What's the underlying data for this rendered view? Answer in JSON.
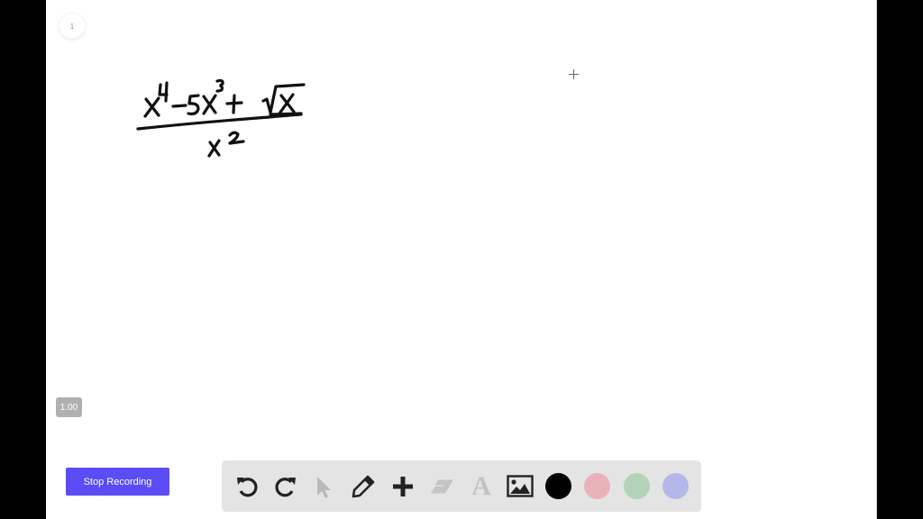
{
  "page": {
    "number": "1"
  },
  "whiteboard": {
    "handwritten_expression": "(x^4 - 5x^3 + √x) / x^2",
    "numerator": "x⁴ − 5x³ + √x",
    "denominator": "x²"
  },
  "zoom_level": "1.00",
  "recording": {
    "stop_label": "Stop Recording"
  },
  "toolbar": {
    "tools": [
      {
        "name": "undo",
        "icon": "undo-icon"
      },
      {
        "name": "redo",
        "icon": "redo-icon"
      },
      {
        "name": "select",
        "icon": "cursor-arrow-icon",
        "state": "disabled"
      },
      {
        "name": "pen",
        "icon": "pencil-icon"
      },
      {
        "name": "add",
        "icon": "plus-icon"
      },
      {
        "name": "eraser",
        "icon": "eraser-icon",
        "state": "disabled"
      },
      {
        "name": "text",
        "icon": "text-icon",
        "label": "A",
        "state": "disabled"
      },
      {
        "name": "image",
        "icon": "image-icon"
      }
    ],
    "colors": [
      {
        "name": "black",
        "hex": "#000000",
        "selected": true
      },
      {
        "name": "red",
        "hex": "#e8b3b8"
      },
      {
        "name": "green",
        "hex": "#b3d3b8"
      },
      {
        "name": "blue",
        "hex": "#b3b8e8"
      }
    ]
  }
}
